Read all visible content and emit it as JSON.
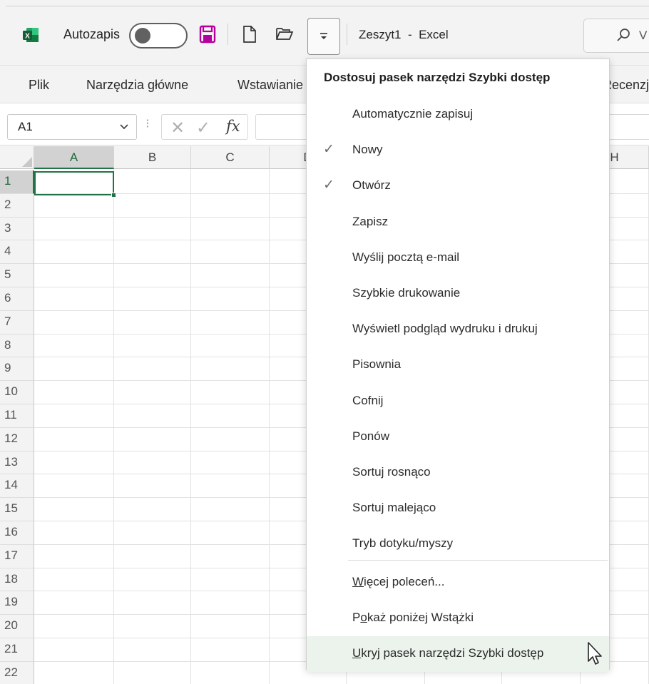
{
  "titlebar": {
    "autosave_label": "Autozapis",
    "doc_title": "Zeszyt1  -  Excel",
    "search_text": "V"
  },
  "ribbon": {
    "tabs": [
      "Plik",
      "Narzędzia główne",
      "Wstawianie",
      "Recenzja"
    ]
  },
  "formula_bar": {
    "name_box": "A1",
    "dots": "⁝",
    "cancel_glyph": "✕",
    "enter_glyph": "✓",
    "fx": "fx"
  },
  "grid": {
    "columns": [
      "A",
      "B",
      "C",
      "D",
      "",
      "",
      "",
      "H"
    ],
    "rows": [
      "1",
      "2",
      "3",
      "4",
      "5",
      "6",
      "7",
      "8",
      "9",
      "10",
      "11",
      "12",
      "13",
      "14",
      "15",
      "16",
      "17",
      "18",
      "19",
      "20",
      "21",
      "22"
    ]
  },
  "menu": {
    "title": "Dostosuj pasek narzędzi Szybki dostęp",
    "check_glyph": "✓",
    "items": [
      {
        "label": "Automatycznie zapisuj",
        "checked": false
      },
      {
        "label": "Nowy",
        "checked": true
      },
      {
        "label": "Otwórz",
        "checked": true
      },
      {
        "label": "Zapisz",
        "checked": false
      },
      {
        "label": "Wyślij pocztą e-mail",
        "checked": false
      },
      {
        "label": "Szybkie drukowanie",
        "checked": false
      },
      {
        "label": "Wyświetl podgląd wydruku i drukuj",
        "checked": false
      },
      {
        "label": "Pisownia",
        "checked": false
      },
      {
        "label": "Cofnij",
        "checked": false
      },
      {
        "label": "Ponów",
        "checked": false
      },
      {
        "label": "Sortuj rosnąco",
        "checked": false
      },
      {
        "label": "Sortuj malejąco",
        "checked": false
      },
      {
        "label": "Tryb dotyku/myszy",
        "checked": false
      }
    ],
    "more_commands": "Więcej poleceń...",
    "show_below": "Pokaż poniżej Wstążki",
    "hide_toolbar": "Ukryj pasek narzędzi Szybki dostęp"
  },
  "colors": {
    "excel_green": "#217346",
    "save_icon": "#b4009e",
    "hover_bg": "#ebf3ec"
  },
  "icons": [
    "excel-logo-icon",
    "save-icon",
    "new-file-icon",
    "open-folder-icon",
    "qat-dropdown-icon",
    "search-icon",
    "chevron-down-icon",
    "mouse-cursor-icon"
  ]
}
